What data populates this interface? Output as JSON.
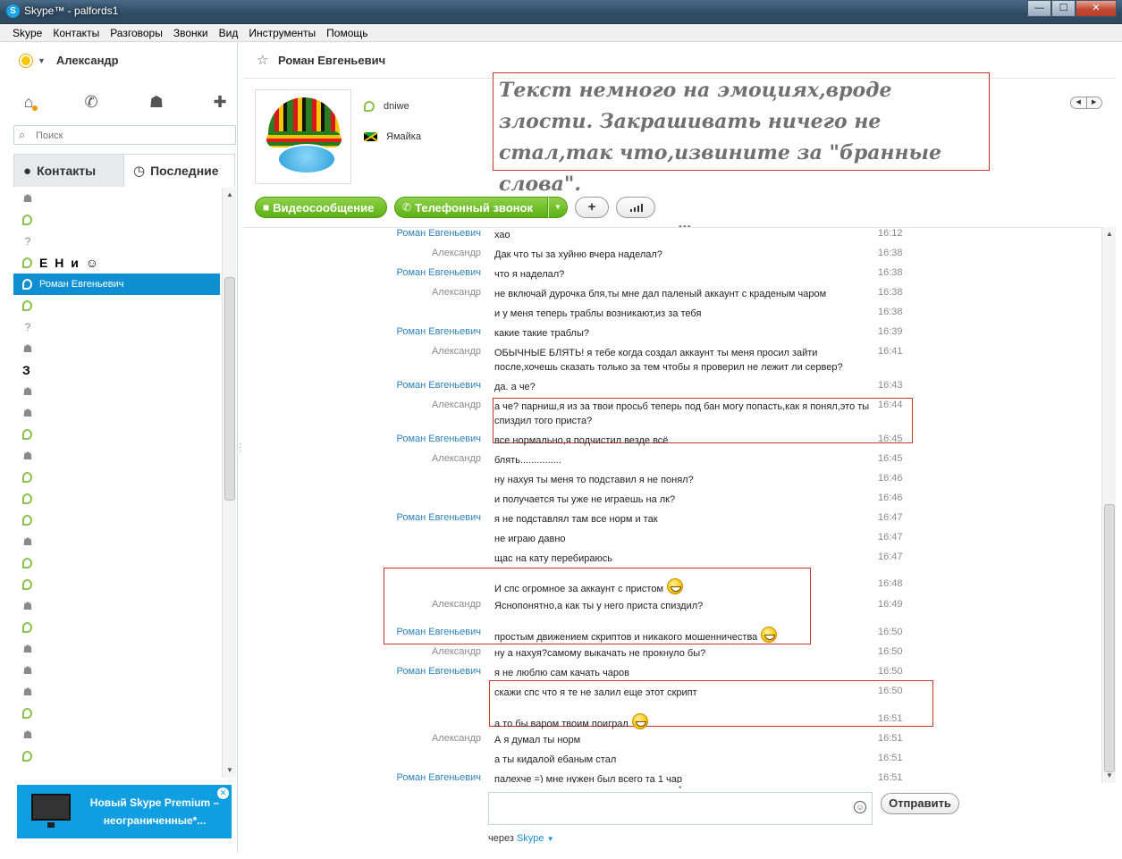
{
  "window": {
    "title": "Skype™ - palfords1",
    "app_icon": "S",
    "min": "—",
    "max": "☐",
    "close": "✕"
  },
  "menu": [
    "Skype",
    "Контакты",
    "Разговоры",
    "Звонки",
    "Вид",
    "Инструменты",
    "Помощь"
  ],
  "user": {
    "name": "Александр",
    "status": "away"
  },
  "search": {
    "placeholder": "Поиск"
  },
  "tabs": {
    "contacts": "Контакты",
    "recent": "Последние"
  },
  "contacts": [
    {
      "icon": "group-icon",
      "label": ""
    },
    {
      "icon": "leaf-status-icon",
      "label": ""
    },
    {
      "icon": "unknown-status-icon",
      "label": ""
    },
    {
      "icon": "leaf-status-icon",
      "label": "Ε Η и ☺"
    },
    {
      "icon": "leaf-status-icon",
      "label": "Роман Евгеньевич",
      "selected": true
    },
    {
      "icon": "leaf-status-icon",
      "label": ""
    },
    {
      "icon": "unknown-status-icon",
      "label": ""
    },
    {
      "icon": "group-icon",
      "label": ""
    },
    {
      "icon": "text",
      "label": "З"
    },
    {
      "icon": "group-icon",
      "label": ""
    },
    {
      "icon": "group-icon",
      "label": ""
    },
    {
      "icon": "leaf-status-icon",
      "label": ""
    },
    {
      "icon": "group-icon",
      "label": ""
    },
    {
      "icon": "leaf-status-icon",
      "label": ""
    },
    {
      "icon": "leaf-status-icon",
      "label": ""
    },
    {
      "icon": "leaf-status-icon",
      "label": ""
    },
    {
      "icon": "group-icon",
      "label": ""
    },
    {
      "icon": "leaf-status-icon",
      "label": ""
    },
    {
      "icon": "leaf-status-icon",
      "label": ""
    },
    {
      "icon": "group-icon",
      "label": ""
    },
    {
      "icon": "leaf-status-icon",
      "label": ""
    },
    {
      "icon": "group-icon",
      "label": ""
    },
    {
      "icon": "group-icon",
      "label": ""
    },
    {
      "icon": "group-icon",
      "label": ""
    },
    {
      "icon": "leaf-status-icon",
      "label": ""
    },
    {
      "icon": "group-icon",
      "label": ""
    },
    {
      "icon": "leaf-status-icon",
      "label": ""
    }
  ],
  "promo": {
    "text": "Новый Skype Premium – неограниченные*..."
  },
  "chat": {
    "contact_name": "Роман Евгеньевич",
    "skype_name": "dniwe",
    "country": "Ямайка",
    "annotation": "Текст немного на эмоциях,вроде злости. Закрашивать ничего не стал,так что,извините за \"бранные слова\".",
    "video_button": "Видеосообщение",
    "call_button": "Телефонный звонок",
    "send_button": "Отправить",
    "via_label": "через",
    "via_link": "Skype"
  },
  "messages": [
    {
      "who": "Роман Евгеньевич",
      "from": "r",
      "text": "хао",
      "time": "16:12"
    },
    {
      "who": "Александр",
      "from": "a",
      "text": "Дак что ты за хуйню вчера наделал?",
      "time": "16:38"
    },
    {
      "who": "Роман Евгеньевич",
      "from": "r",
      "text": "что я наделал?",
      "time": "16:38"
    },
    {
      "who": "Александр",
      "from": "a",
      "text": "не включай дурочка бля,ты мне дал паленый аккаунт с краденым чаром",
      "time": "16:38"
    },
    {
      "who": "",
      "from": "a",
      "text": "и у меня теперь траблы возникают,из за тебя",
      "time": "16:38"
    },
    {
      "who": "Роман Евгеньевич",
      "from": "r",
      "text": "какие такие траблы?",
      "time": "16:39"
    },
    {
      "who": "Александр",
      "from": "a",
      "text": "ОБЫЧНЫЕ БЛЯТЬ! я тебе когда создал аккаунт ты меня просил зайти после,хочешь сказать только за тем чтобы я проверил не лежит ли сервер?",
      "time": "16:41"
    },
    {
      "who": "Роман Евгеньевич",
      "from": "r",
      "text": "да. а че?",
      "time": "16:43"
    },
    {
      "who": "Александр",
      "from": "a",
      "text": "а че? парниш,я из за твои просьб теперь под бан могу попасть,как я понял,это ты спиздил того приста?",
      "time": "16:44"
    },
    {
      "who": "Роман Евгеньевич",
      "from": "r",
      "text": "все нормально,я подчистил везде всё",
      "time": "16:45"
    },
    {
      "who": "Александр",
      "from": "a",
      "text": "блять...............",
      "time": "16:45"
    },
    {
      "who": "",
      "from": "a",
      "text": "ну нахуя ты меня то подставил я не понял?",
      "time": "16:46"
    },
    {
      "who": "",
      "from": "a",
      "text": "и получается ты уже не играешь на лк?",
      "time": "16:46"
    },
    {
      "who": "Роман Евгеньевич",
      "from": "r",
      "text": "я не подставлял там все норм и так",
      "time": "16:47"
    },
    {
      "who": "",
      "from": "r",
      "text": "не играю давно",
      "time": "16:47"
    },
    {
      "who": "",
      "from": "r",
      "text": "щас на кату перебираюсь",
      "time": "16:47"
    },
    {
      "who": "",
      "from": "r",
      "text": "И спс огромное за аккаунт с пристом",
      "time": "16:48",
      "smile": true
    },
    {
      "who": "Александр",
      "from": "a",
      "text": "Яснопонятно,а как ты у него приста спиздил?",
      "time": "16:49"
    },
    {
      "who": "Роман Евгеньевич",
      "from": "r",
      "text": "простым движением скриптов и никакого мошенничества",
      "time": "16:50",
      "smile": true
    },
    {
      "who": "Александр",
      "from": "a",
      "text": "ну а нахуя?самому выкачать не прокнуло бы?",
      "time": "16:50"
    },
    {
      "who": "Роман Евгеньевич",
      "from": "r",
      "text": "я не люблю сам качать чаров",
      "time": "16:50"
    },
    {
      "who": "",
      "from": "r",
      "text": "скажи спс что я те не залил еще этот скрипт",
      "time": "16:50"
    },
    {
      "who": "",
      "from": "r",
      "text": "а то бы варом твоим поиграл",
      "time": "16:51",
      "smile": true
    },
    {
      "who": "Александр",
      "from": "a",
      "text": "А я думал ты норм",
      "time": "16:51"
    },
    {
      "who": "",
      "from": "a",
      "text": "а ты кидалой ебаным стал",
      "time": "16:51"
    },
    {
      "who": "Роман Евгеньевич",
      "from": "r",
      "text": "палехче =) мне нужен был всего та 1 чар",
      "time": "16:51"
    }
  ]
}
